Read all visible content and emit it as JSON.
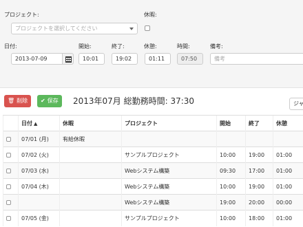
{
  "form": {
    "project_label": "プロジェクト:",
    "project_placeholder": "プロジェクトを選択してください",
    "holiday_label": "休暇:",
    "date_label": "日付:",
    "date_value": "2013-07-09",
    "start_label": "開始:",
    "start_value": "10:01",
    "end_label": "終了:",
    "end_value": "19:02",
    "break_label": "休憩:",
    "break_value": "01:11",
    "time_label": "時間:",
    "time_value": "07:50",
    "note_label": "備考:",
    "note_placeholder": "備考"
  },
  "toolbar": {
    "delete_label": "削除",
    "save_label": "保存",
    "summary": "2013年07月 総勤務時間: 37:30",
    "extra_label": "ジャ"
  },
  "table": {
    "headers": {
      "date": "日付",
      "holiday": "休暇",
      "project": "プロジェクト",
      "start": "開始",
      "end": "終了",
      "break": "休憩"
    },
    "rows": [
      {
        "date": "07/01 (月)",
        "holiday": "有給休暇",
        "project": "",
        "start": "",
        "end": "",
        "break": ""
      },
      {
        "date": "07/02 (火)",
        "holiday": "",
        "project": "サンプルプロジェクト",
        "start": "10:00",
        "end": "19:00",
        "break": "01:00"
      },
      {
        "date": "07/03 (水)",
        "holiday": "",
        "project": "Webシステム構築",
        "start": "09:30",
        "end": "17:00",
        "break": "01:00"
      },
      {
        "date": "07/04 (木)",
        "holiday": "",
        "project": "Webシステム構築",
        "start": "10:00",
        "end": "19:00",
        "break": "01:00"
      },
      {
        "date": "",
        "holiday": "",
        "project": "Webシステム構築",
        "start": "19:00",
        "end": "20:00",
        "break": "00:00"
      },
      {
        "date": "07/05 (金)",
        "holiday": "",
        "project": "サンプルプロジェクト",
        "start": "10:00",
        "end": "18:00",
        "break": "01:00"
      }
    ]
  },
  "colors": {
    "danger": "#d9534f",
    "success": "#5cb85c",
    "panel_bg": "#f5f5f5"
  },
  "icons": {
    "delete": "trash-icon",
    "save": "check-icon",
    "calendar": "calendar-icon",
    "sort": "sort-up-icon"
  }
}
